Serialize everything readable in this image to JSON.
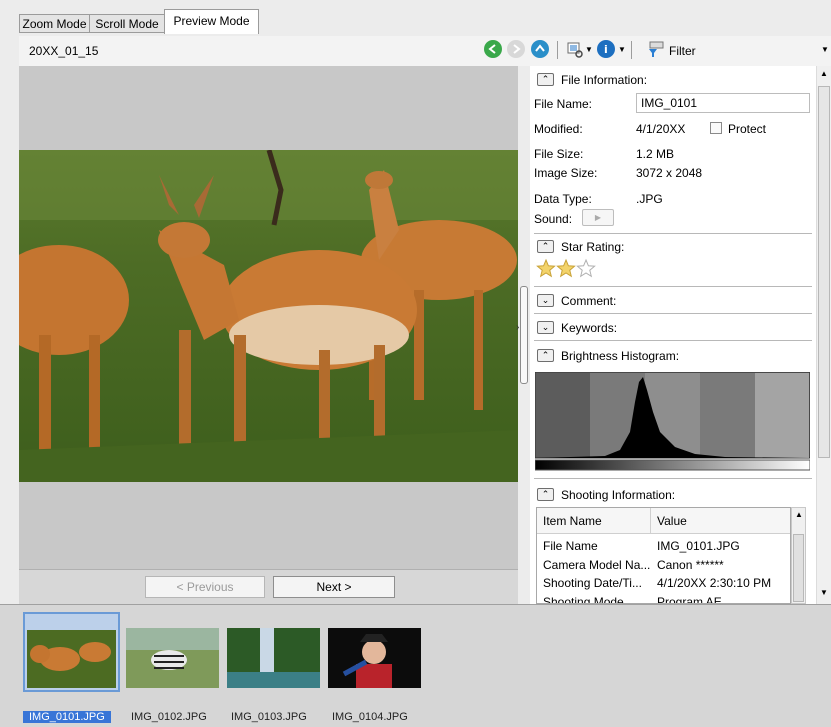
{
  "tabs": [
    {
      "label": "Zoom Mode"
    },
    {
      "label": "Scroll Mode"
    },
    {
      "label": "Preview Mode"
    }
  ],
  "toolbar": {
    "folder_path": "20XX_01_15",
    "filter_label": "Filter"
  },
  "navigation": {
    "previous_label": "< Previous",
    "next_label": "Next >"
  },
  "file_info": {
    "header": "File Information:",
    "file_name_label": "File Name:",
    "file_name_value": "IMG_0101",
    "modified_label": "Modified:",
    "modified_value": "4/1/20XX",
    "protect_label": "Protect",
    "file_size_label": "File Size:",
    "file_size_value": "1.2 MB",
    "image_size_label": "Image Size:",
    "image_size_value": "3072 x 2048",
    "data_type_label": "Data Type:",
    "data_type_value": ".JPG",
    "sound_label": "Sound:"
  },
  "star_rating": {
    "header": "Star Rating:",
    "value": 2,
    "max": 3
  },
  "sections": {
    "comment": "Comment:",
    "keywords": "Keywords:",
    "histogram": "Brightness Histogram:",
    "shooting": "Shooting Information:"
  },
  "shooting_table": {
    "columns": [
      "Item Name",
      "Value"
    ],
    "rows": [
      [
        "File Name",
        "IMG_0101.JPG"
      ],
      [
        "Camera Model Na...",
        "Canon ******"
      ],
      [
        "Shooting Date/Ti...",
        "4/1/20XX 2:30:10 PM"
      ],
      [
        "Shooting Mode",
        "Program AE"
      ]
    ]
  },
  "thumbnails": [
    {
      "label": "IMG_0101.JPG",
      "selected": true
    },
    {
      "label": "IMG_0102.JPG",
      "selected": false
    },
    {
      "label": "IMG_0103.JPG",
      "selected": false
    },
    {
      "label": "IMG_0104.JPG",
      "selected": false
    }
  ],
  "colors": {
    "accent_green": "#3aa84a",
    "accent_blue": "#2a7fd4",
    "selection": "#3875d7"
  }
}
